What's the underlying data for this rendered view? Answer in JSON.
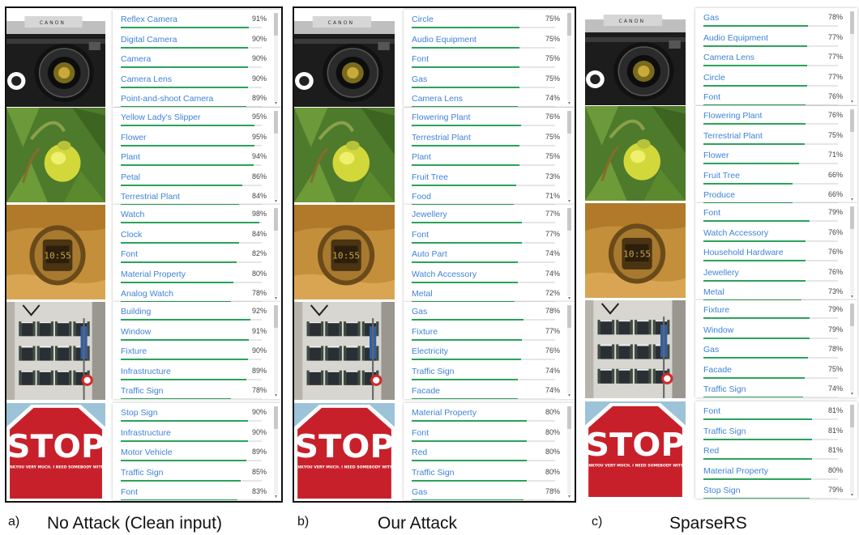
{
  "panels": [
    {
      "id": "a",
      "caption_letter": "a)",
      "caption": "No Attack (Clean input)",
      "rows": [
        {
          "image": "camera",
          "labels": [
            {
              "name": "Reflex Camera",
              "pct": "91%",
              "value": 0.91
            },
            {
              "name": "Digital Camera",
              "pct": "90%",
              "value": 0.9
            },
            {
              "name": "Camera",
              "pct": "90%",
              "value": 0.9
            },
            {
              "name": "Camera Lens",
              "pct": "90%",
              "value": 0.9
            },
            {
              "name": "Point-and-shoot Camera",
              "pct": "89%",
              "value": 0.89
            }
          ]
        },
        {
          "image": "flower",
          "labels": [
            {
              "name": "Yellow Lady's Slipper",
              "pct": "95%",
              "value": 0.95
            },
            {
              "name": "Flower",
              "pct": "95%",
              "value": 0.95
            },
            {
              "name": "Plant",
              "pct": "94%",
              "value": 0.94
            },
            {
              "name": "Petal",
              "pct": "86%",
              "value": 0.86
            },
            {
              "name": "Terrestrial Plant",
              "pct": "84%",
              "value": 0.84
            }
          ]
        },
        {
          "image": "watch",
          "labels": [
            {
              "name": "Watch",
              "pct": "98%",
              "value": 0.98
            },
            {
              "name": "Clock",
              "pct": "84%",
              "value": 0.84
            },
            {
              "name": "Font",
              "pct": "82%",
              "value": 0.82
            },
            {
              "name": "Material Property",
              "pct": "80%",
              "value": 0.8
            },
            {
              "name": "Analog Watch",
              "pct": "78%",
              "value": 0.78
            }
          ]
        },
        {
          "image": "building",
          "labels": [
            {
              "name": "Building",
              "pct": "92%",
              "value": 0.92
            },
            {
              "name": "Window",
              "pct": "91%",
              "value": 0.91
            },
            {
              "name": "Fixture",
              "pct": "90%",
              "value": 0.9
            },
            {
              "name": "Infrastructure",
              "pct": "89%",
              "value": 0.89
            },
            {
              "name": "Traffic Sign",
              "pct": "78%",
              "value": 0.78
            }
          ]
        },
        {
          "image": "stop",
          "labels": [
            {
              "name": "Stop Sign",
              "pct": "90%",
              "value": 0.9
            },
            {
              "name": "Infrastructure",
              "pct": "90%",
              "value": 0.9
            },
            {
              "name": "Motor Vehicle",
              "pct": "89%",
              "value": 0.89
            },
            {
              "name": "Traffic Sign",
              "pct": "85%",
              "value": 0.85
            },
            {
              "name": "Font",
              "pct": "83%",
              "value": 0.83
            }
          ]
        }
      ]
    },
    {
      "id": "b",
      "caption_letter": "b)",
      "caption": "Our Attack",
      "rows": [
        {
          "image": "camera",
          "labels": [
            {
              "name": "Circle",
              "pct": "75%",
              "value": 0.75
            },
            {
              "name": "Audio Equipment",
              "pct": "75%",
              "value": 0.75
            },
            {
              "name": "Font",
              "pct": "75%",
              "value": 0.75
            },
            {
              "name": "Gas",
              "pct": "75%",
              "value": 0.75
            },
            {
              "name": "Camera Lens",
              "pct": "74%",
              "value": 0.74
            }
          ]
        },
        {
          "image": "flower",
          "labels": [
            {
              "name": "Flowering Plant",
              "pct": "76%",
              "value": 0.76
            },
            {
              "name": "Terrestrial Plant",
              "pct": "75%",
              "value": 0.75
            },
            {
              "name": "Plant",
              "pct": "75%",
              "value": 0.75
            },
            {
              "name": "Fruit Tree",
              "pct": "73%",
              "value": 0.73
            },
            {
              "name": "Food",
              "pct": "71%",
              "value": 0.71
            }
          ]
        },
        {
          "image": "watch",
          "labels": [
            {
              "name": "Jewellery",
              "pct": "77%",
              "value": 0.77
            },
            {
              "name": "Font",
              "pct": "77%",
              "value": 0.77
            },
            {
              "name": "Auto Part",
              "pct": "74%",
              "value": 0.74
            },
            {
              "name": "Watch Accessory",
              "pct": "74%",
              "value": 0.74
            },
            {
              "name": "Metal",
              "pct": "72%",
              "value": 0.72
            }
          ]
        },
        {
          "image": "building",
          "labels": [
            {
              "name": "Gas",
              "pct": "78%",
              "value": 0.78
            },
            {
              "name": "Fixture",
              "pct": "77%",
              "value": 0.77
            },
            {
              "name": "Electricity",
              "pct": "76%",
              "value": 0.76
            },
            {
              "name": "Traffic Sign",
              "pct": "74%",
              "value": 0.74
            },
            {
              "name": "Facade",
              "pct": "74%",
              "value": 0.74
            }
          ]
        },
        {
          "image": "stop",
          "labels": [
            {
              "name": "Material Property",
              "pct": "80%",
              "value": 0.8
            },
            {
              "name": "Font",
              "pct": "80%",
              "value": 0.8
            },
            {
              "name": "Red",
              "pct": "80%",
              "value": 0.8
            },
            {
              "name": "Traffic Sign",
              "pct": "80%",
              "value": 0.8
            },
            {
              "name": "Gas",
              "pct": "78%",
              "value": 0.78
            }
          ]
        }
      ]
    },
    {
      "id": "c",
      "caption_letter": "c)",
      "caption": "SparseRS",
      "rows": [
        {
          "image": "camera",
          "labels": [
            {
              "name": "Gas",
              "pct": "78%",
              "value": 0.78
            },
            {
              "name": "Audio Equipment",
              "pct": "77%",
              "value": 0.77
            },
            {
              "name": "Camera Lens",
              "pct": "77%",
              "value": 0.77
            },
            {
              "name": "Circle",
              "pct": "77%",
              "value": 0.77
            },
            {
              "name": "Font",
              "pct": "76%",
              "value": 0.76
            }
          ]
        },
        {
          "image": "flower",
          "labels": [
            {
              "name": "Flowering Plant",
              "pct": "76%",
              "value": 0.76
            },
            {
              "name": "Terrestrial Plant",
              "pct": "75%",
              "value": 0.75
            },
            {
              "name": "Flower",
              "pct": "71%",
              "value": 0.71
            },
            {
              "name": "Fruit Tree",
              "pct": "66%",
              "value": 0.66
            },
            {
              "name": "Produce",
              "pct": "66%",
              "value": 0.66
            }
          ]
        },
        {
          "image": "watch",
          "labels": [
            {
              "name": "Font",
              "pct": "79%",
              "value": 0.79
            },
            {
              "name": "Watch Accessory",
              "pct": "76%",
              "value": 0.76
            },
            {
              "name": "Household Hardware",
              "pct": "76%",
              "value": 0.76
            },
            {
              "name": "Jewellery",
              "pct": "76%",
              "value": 0.76
            },
            {
              "name": "Metal",
              "pct": "73%",
              "value": 0.73
            }
          ]
        },
        {
          "image": "building",
          "labels": [
            {
              "name": "Fixture",
              "pct": "79%",
              "value": 0.79
            },
            {
              "name": "Window",
              "pct": "79%",
              "value": 0.79
            },
            {
              "name": "Gas",
              "pct": "78%",
              "value": 0.78
            },
            {
              "name": "Facade",
              "pct": "75%",
              "value": 0.75
            },
            {
              "name": "Traffic Sign",
              "pct": "74%",
              "value": 0.74
            }
          ]
        },
        {
          "image": "stop",
          "labels": [
            {
              "name": "Font",
              "pct": "81%",
              "value": 0.81
            },
            {
              "name": "Traffic Sign",
              "pct": "81%",
              "value": 0.81
            },
            {
              "name": "Red",
              "pct": "81%",
              "value": 0.81
            },
            {
              "name": "Material Property",
              "pct": "80%",
              "value": 0.8
            },
            {
              "name": "Stop Sign",
              "pct": "79%",
              "value": 0.79
            }
          ]
        }
      ]
    }
  ],
  "images": {
    "camera": {
      "brand_text": "C A N O N"
    },
    "stop": {
      "sign_text": "STOP",
      "sticker_text": "RIGHT THERE. THANKYOU VERY MUCH. I NEED SOMEBODY WITH A HUMAN TOUCH"
    }
  },
  "colors": {
    "label_text": "#3f83d9",
    "bar_fill": "#2aa35b",
    "bar_track": "#e6e6e6",
    "frame": "#111111"
  }
}
